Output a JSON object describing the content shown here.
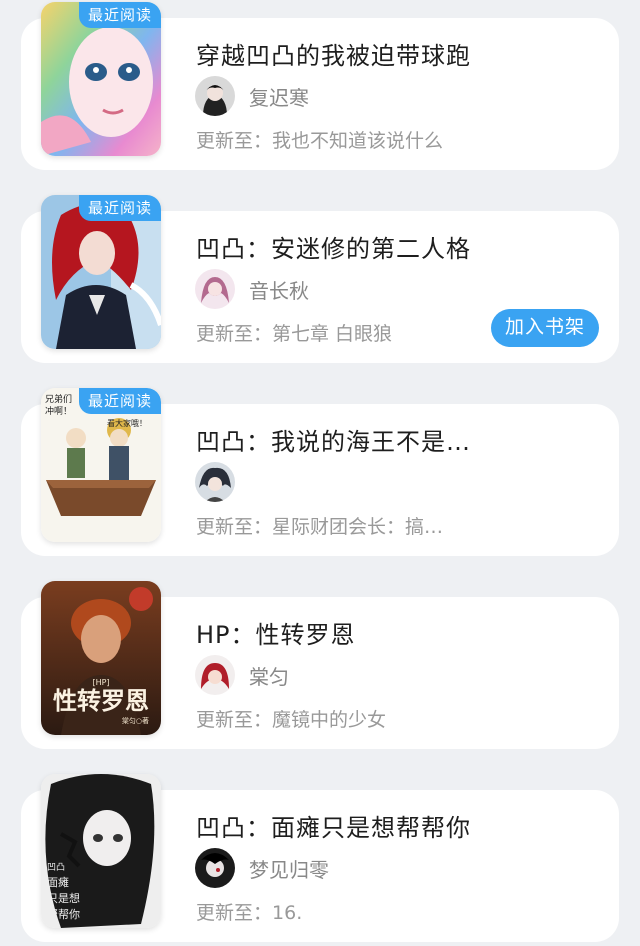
{
  "books": [
    {
      "title": "穿越凹凸的我被迫带球跑",
      "author": "复迟寒",
      "update_label": "更新至：",
      "update_text": "我也不知道该说什么",
      "badge": "最近阅读",
      "button": null
    },
    {
      "title": "凹凸：安迷修的第二人格",
      "author": "音长秋",
      "update_label": "更新至：",
      "update_text": "第七章 白眼狼",
      "badge": "最近阅读",
      "button": "加入书架"
    },
    {
      "title": "凹凸：我说的海王不是…",
      "author": "",
      "update_label": "更新至：",
      "update_text": "星际财团会长：搞…",
      "badge": "最近阅读",
      "button": null,
      "cover_text": [
        "兄弟们",
        "冲啊！",
        "看大家哦！"
      ]
    },
    {
      "title": "HP：性转罗恩",
      "author": "棠匀",
      "update_label": "更新至：",
      "update_text": "魔镜中的少女",
      "badge": null,
      "button": null,
      "cover_text": [
        "[HP]",
        "性转罗恩",
        "棠匀○著"
      ]
    },
    {
      "title": "凹凸：面瘫只是想帮帮你",
      "author": "梦见归零",
      "update_label": "更新至：",
      "update_text": "16.",
      "badge": null,
      "button": null,
      "cover_text": [
        "凹凸",
        "面瘫",
        "只是想",
        "帮帮你"
      ]
    }
  ],
  "colors": {
    "accent": "#3aa3f2",
    "background": "#eef0f3",
    "card": "#ffffff"
  }
}
